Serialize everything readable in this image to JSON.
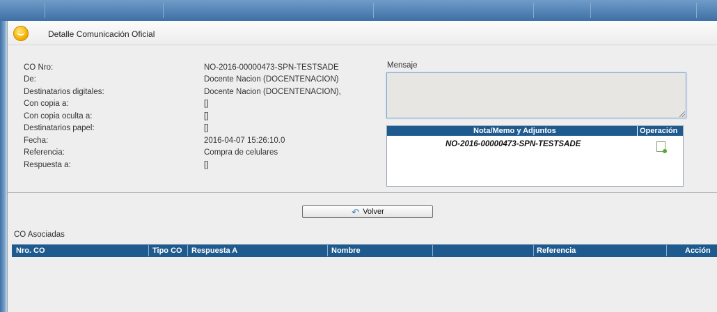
{
  "window": {
    "title": "Detalle Comunicación Oficial"
  },
  "details": [
    {
      "label": "CO Nro:",
      "value": "NO-2016-00000473-SPN-TESTSADE"
    },
    {
      "label": "De:",
      "value": "Docente Nacion (DOCENTENACION)"
    },
    {
      "label": "Destinatarios digitales:",
      "value": "Docente Nacion (DOCENTENACION),"
    },
    {
      "label": "Con copia a:",
      "value": "[]"
    },
    {
      "label": "Con copia oculta a:",
      "value": "[]"
    },
    {
      "label": "Destinatarios papel:",
      "value": "[]"
    },
    {
      "label": "Fecha:",
      "value": "2016-04-07 15:26:10.0"
    },
    {
      "label": "Referencia:",
      "value": "Compra de celulares"
    },
    {
      "label": "Respuesta a:",
      "value": "[]"
    }
  ],
  "message": {
    "label": "Mensaje",
    "value": ""
  },
  "attachments": {
    "headers": [
      "Nota/Memo y Adjuntos",
      "Operación"
    ],
    "rows": [
      {
        "name": "NO-2016-00000473-SPN-TESTSADE",
        "operation_icon": "document-add-icon"
      }
    ]
  },
  "actions": {
    "volver_label": "Volver"
  },
  "associated": {
    "label": "CO Asociadas",
    "headers": [
      "Nro. CO",
      "Tipo CO",
      "Respuesta A",
      "Nombre",
      "",
      "Referencia",
      "Acción"
    ],
    "rows": []
  },
  "colors": {
    "header_blue": "#1f5a8e",
    "top_bar": "#3f6fa6",
    "accent_icon": "#f5b400"
  }
}
